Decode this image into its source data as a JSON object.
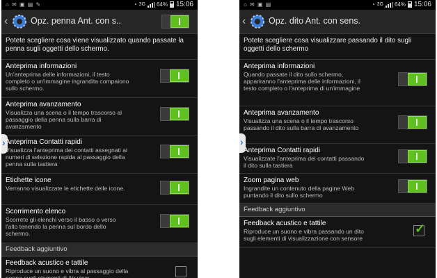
{
  "status_bar": {
    "time": "15:06",
    "battery_level": "64%"
  },
  "left": {
    "title": "Opz. penna Ant. con s..",
    "description": "Potete scegliere cosa viene visualizzato quando passate la penna sugli oggetti dello schermo.",
    "items": [
      {
        "title": "Anteprima informazioni",
        "subtitle": "Un'anteprima delle informazioni, il testo completo o un'immagine ingrandita compaiono sullo schermo."
      },
      {
        "title": "Anteprima avanzamento",
        "subtitle": "Visualizza una scena o il tempo trascorso al passaggio della penna sulla barra di avanzamento"
      },
      {
        "title": "Anteprima Contatti rapidi",
        "subtitle": "Visualizza l'anteprima dei contatti assegnati ai numeri di selezione rapida al passaggio della penna sulla tastiera"
      },
      {
        "title": "Etichette icone",
        "subtitle": "Verranno visualizzate le etichette delle icone."
      },
      {
        "title": "Scorrimento elenco",
        "subtitle": "Scorrete gli elenchi verso il basso o verso l'alto tenendo la penna sul bordo dello schermo."
      }
    ],
    "section_header": "Feedback aggiuntivo",
    "feedback": {
      "title": "Feedback acustico e tattile",
      "subtitle": "Riproduce un suono e vibra al passaggio della penna sugli elementi di Air view",
      "checked": false
    }
  },
  "right": {
    "title": "Opz. dito Ant. con sens.",
    "description": "Potete scegliere cosa visualizzare passando il dito sugli oggetti dello schermo",
    "items": [
      {
        "title": "Anteprima informazioni",
        "subtitle": "Quando passate il dito sullo schermo, appariranno l'anteprima delle informazioni, il testo completo o l'anteprima di un'immagine"
      },
      {
        "title": "Anteprima avanzamento",
        "subtitle": "Visualizza una scena o il tempo trascorso passando il dito sulla barra di avanzamento"
      },
      {
        "title": "Anteprima Contatti rapidi",
        "subtitle": "Visualizzate l'anteprima dei contatti passando il dito sulla tastiera"
      },
      {
        "title": "Zoom pagina web",
        "subtitle": "Ingrandite un contenuto della pagine Web puntando il dito sullo schermo"
      }
    ],
    "section_header": "Feedback aggiuntivo",
    "feedback": {
      "title": "Feedback acustico e tattile",
      "subtitle": "Riproduce un suono e vibra passando un dito sugli elementi di visualizzazione con sensore",
      "checked": true
    }
  },
  "colors": {
    "switch_on": "#5fc020",
    "background": "#141414",
    "accent": "#3a7bd5"
  },
  "icons": [
    "back-icon",
    "gear-icon",
    "wifi-icon",
    "signal-icon",
    "battery-icon",
    "check-icon",
    "side-tab-icon"
  ]
}
